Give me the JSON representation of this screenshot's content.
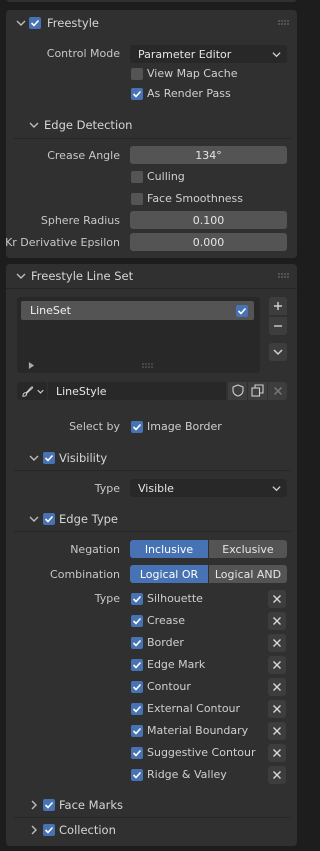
{
  "freestyle": {
    "title": "Freestyle",
    "control_mode_label": "Control Mode",
    "control_mode_value": "Parameter Editor",
    "view_map_cache": "View Map Cache",
    "as_render_pass": "As Render Pass"
  },
  "edge_detection": {
    "title": "Edge Detection",
    "crease_angle_label": "Crease Angle",
    "crease_angle_value": "134°",
    "culling": "Culling",
    "face_smoothness": "Face Smoothness",
    "sphere_radius_label": "Sphere Radius",
    "sphere_radius_value": "0.100",
    "kr_label": "Kr Derivative Epsilon",
    "kr_value": "0.000"
  },
  "lineset": {
    "title": "Freestyle Line Set",
    "item_name": "LineSet",
    "linestyle_name": "LineStyle",
    "select_by_label": "Select by",
    "image_border": "Image Border"
  },
  "visibility": {
    "title": "Visibility",
    "type_label": "Type",
    "type_value": "Visible"
  },
  "edge_type": {
    "title": "Edge Type",
    "negation_label": "Negation",
    "negation_options": [
      "Inclusive",
      "Exclusive"
    ],
    "combination_label": "Combination",
    "combination_options": [
      "Logical OR",
      "Logical AND"
    ],
    "type_label": "Type",
    "types": [
      "Silhouette",
      "Crease",
      "Border",
      "Edge Mark",
      "Contour",
      "External Contour",
      "Material Boundary",
      "Suggestive Contour",
      "Ridge & Valley"
    ]
  },
  "face_marks": {
    "title": "Face Marks"
  },
  "collection": {
    "title": "Collection"
  },
  "colors": {
    "accent": "#4772b3",
    "panel": "#303030",
    "background": "#1d1d1d",
    "field": "#545454"
  }
}
